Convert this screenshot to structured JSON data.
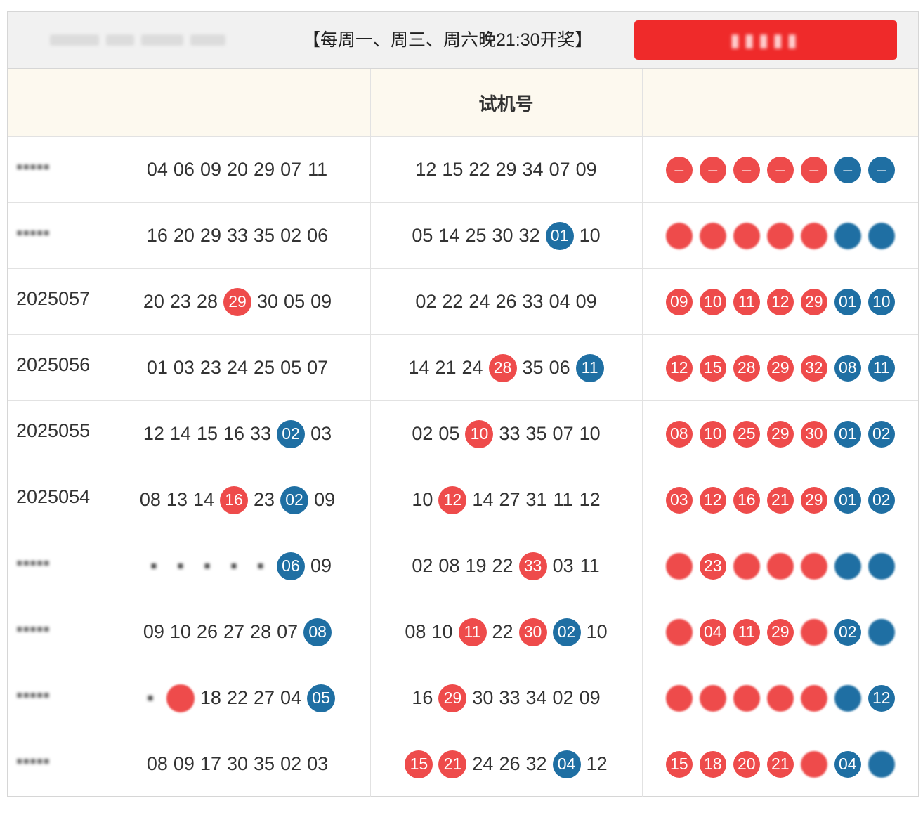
{
  "header": {
    "schedule": "【每周一、周三、周六晚21:30开奖】"
  },
  "table": {
    "col3_header": "试机号",
    "rows": [
      {
        "issue": "",
        "issue_blurred": true,
        "draw": [
          {
            "v": "04"
          },
          {
            "v": "06"
          },
          {
            "v": "09"
          },
          {
            "v": "20"
          },
          {
            "v": "29"
          },
          {
            "v": "07"
          },
          {
            "v": "11"
          }
        ],
        "trial": [
          {
            "v": "12"
          },
          {
            "v": "15"
          },
          {
            "v": "22"
          },
          {
            "v": "29"
          },
          {
            "v": "34"
          },
          {
            "v": "07"
          },
          {
            "v": "09"
          }
        ],
        "result": [
          {
            "v": "–",
            "c": "red"
          },
          {
            "v": "–",
            "c": "red"
          },
          {
            "v": "–",
            "c": "red"
          },
          {
            "v": "–",
            "c": "red"
          },
          {
            "v": "–",
            "c": "red"
          },
          {
            "v": "–",
            "c": "blue"
          },
          {
            "v": "–",
            "c": "blue"
          }
        ]
      },
      {
        "issue": "",
        "issue_blurred": true,
        "draw": [
          {
            "v": "16"
          },
          {
            "v": "20"
          },
          {
            "v": "29"
          },
          {
            "v": "33"
          },
          {
            "v": "35"
          },
          {
            "v": "02"
          },
          {
            "v": "06"
          }
        ],
        "trial": [
          {
            "v": "05"
          },
          {
            "v": "14"
          },
          {
            "v": "25"
          },
          {
            "v": "30"
          },
          {
            "v": "32"
          },
          {
            "v": "01",
            "c": "blue"
          },
          {
            "v": "10"
          }
        ],
        "result": [
          {
            "v": "",
            "c": "red",
            "b": true
          },
          {
            "v": "",
            "c": "red",
            "b": true
          },
          {
            "v": "",
            "c": "red",
            "b": true
          },
          {
            "v": "",
            "c": "red",
            "b": true
          },
          {
            "v": "",
            "c": "red",
            "b": true
          },
          {
            "v": "",
            "c": "blue",
            "b": true
          },
          {
            "v": "",
            "c": "blue",
            "b": true
          }
        ]
      },
      {
        "issue": "2025057",
        "draw": [
          {
            "v": "20"
          },
          {
            "v": "23"
          },
          {
            "v": "28"
          },
          {
            "v": "29",
            "c": "red"
          },
          {
            "v": "30"
          },
          {
            "v": "05"
          },
          {
            "v": "09"
          }
        ],
        "trial": [
          {
            "v": "02"
          },
          {
            "v": "22"
          },
          {
            "v": "24"
          },
          {
            "v": "26"
          },
          {
            "v": "33"
          },
          {
            "v": "04"
          },
          {
            "v": "09"
          }
        ],
        "result": [
          {
            "v": "09",
            "c": "red"
          },
          {
            "v": "10",
            "c": "red"
          },
          {
            "v": "11",
            "c": "red"
          },
          {
            "v": "12",
            "c": "red"
          },
          {
            "v": "29",
            "c": "red"
          },
          {
            "v": "01",
            "c": "blue"
          },
          {
            "v": "10",
            "c": "blue"
          }
        ]
      },
      {
        "issue": "2025056",
        "draw": [
          {
            "v": "01"
          },
          {
            "v": "03"
          },
          {
            "v": "23"
          },
          {
            "v": "24"
          },
          {
            "v": "25"
          },
          {
            "v": "05"
          },
          {
            "v": "07"
          }
        ],
        "trial": [
          {
            "v": "14"
          },
          {
            "v": "21"
          },
          {
            "v": "24"
          },
          {
            "v": "28",
            "c": "red"
          },
          {
            "v": "35"
          },
          {
            "v": "06"
          },
          {
            "v": "11",
            "c": "blue"
          }
        ],
        "result": [
          {
            "v": "12",
            "c": "red"
          },
          {
            "v": "15",
            "c": "red"
          },
          {
            "v": "28",
            "c": "red"
          },
          {
            "v": "29",
            "c": "red"
          },
          {
            "v": "32",
            "c": "red"
          },
          {
            "v": "08",
            "c": "blue"
          },
          {
            "v": "11",
            "c": "blue"
          }
        ]
      },
      {
        "issue": "2025055",
        "draw": [
          {
            "v": "12"
          },
          {
            "v": "14"
          },
          {
            "v": "15"
          },
          {
            "v": "16"
          },
          {
            "v": "33"
          },
          {
            "v": "02",
            "c": "blue"
          },
          {
            "v": "03"
          }
        ],
        "trial": [
          {
            "v": "02"
          },
          {
            "v": "05"
          },
          {
            "v": "10",
            "c": "red"
          },
          {
            "v": "33"
          },
          {
            "v": "35"
          },
          {
            "v": "07"
          },
          {
            "v": "10"
          }
        ],
        "result": [
          {
            "v": "08",
            "c": "red"
          },
          {
            "v": "10",
            "c": "red"
          },
          {
            "v": "25",
            "c": "red"
          },
          {
            "v": "29",
            "c": "red"
          },
          {
            "v": "30",
            "c": "red"
          },
          {
            "v": "01",
            "c": "blue"
          },
          {
            "v": "02",
            "c": "blue"
          }
        ]
      },
      {
        "issue": "2025054",
        "draw": [
          {
            "v": "08"
          },
          {
            "v": "13"
          },
          {
            "v": "14"
          },
          {
            "v": "16",
            "c": "red"
          },
          {
            "v": "23"
          },
          {
            "v": "02",
            "c": "blue"
          },
          {
            "v": "09"
          }
        ],
        "trial": [
          {
            "v": "10"
          },
          {
            "v": "12",
            "c": "red"
          },
          {
            "v": "14"
          },
          {
            "v": "27"
          },
          {
            "v": "31"
          },
          {
            "v": "11"
          },
          {
            "v": "12"
          }
        ],
        "result": [
          {
            "v": "03",
            "c": "red"
          },
          {
            "v": "12",
            "c": "red"
          },
          {
            "v": "16",
            "c": "red"
          },
          {
            "v": "21",
            "c": "red"
          },
          {
            "v": "29",
            "c": "red"
          },
          {
            "v": "01",
            "c": "blue"
          },
          {
            "v": "02",
            "c": "blue"
          }
        ]
      },
      {
        "issue": "",
        "issue_blurred": true,
        "draw": [
          {
            "v": "",
            "b": true
          },
          {
            "v": "",
            "b": true
          },
          {
            "v": "",
            "b": true
          },
          {
            "v": "",
            "b": true
          },
          {
            "v": "",
            "b": true
          },
          {
            "v": "06",
            "c": "blue"
          },
          {
            "v": "09"
          }
        ],
        "trial": [
          {
            "v": "02"
          },
          {
            "v": "08"
          },
          {
            "v": "19"
          },
          {
            "v": "22"
          },
          {
            "v": "33",
            "c": "red"
          },
          {
            "v": "03"
          },
          {
            "v": "11"
          }
        ],
        "result": [
          {
            "v": "",
            "c": "red",
            "b": true
          },
          {
            "v": "23",
            "c": "red"
          },
          {
            "v": "",
            "c": "red",
            "b": true
          },
          {
            "v": "",
            "c": "red",
            "b": true
          },
          {
            "v": "",
            "c": "red",
            "b": true
          },
          {
            "v": "",
            "c": "blue",
            "b": true
          },
          {
            "v": "",
            "c": "blue",
            "b": true
          }
        ]
      },
      {
        "issue": "",
        "issue_blurred": true,
        "draw": [
          {
            "v": "09"
          },
          {
            "v": "10"
          },
          {
            "v": "26"
          },
          {
            "v": "27"
          },
          {
            "v": "28"
          },
          {
            "v": "07"
          },
          {
            "v": "08",
            "c": "blue"
          }
        ],
        "trial": [
          {
            "v": "08"
          },
          {
            "v": "10"
          },
          {
            "v": "11",
            "c": "red"
          },
          {
            "v": "22"
          },
          {
            "v": "30",
            "c": "red"
          },
          {
            "v": "02",
            "c": "blue"
          },
          {
            "v": "10"
          }
        ],
        "result": [
          {
            "v": "",
            "c": "red",
            "b": true
          },
          {
            "v": "04",
            "c": "red"
          },
          {
            "v": "11",
            "c": "red"
          },
          {
            "v": "29",
            "c": "red"
          },
          {
            "v": "",
            "c": "red",
            "b": true
          },
          {
            "v": "02",
            "c": "blue"
          },
          {
            "v": "",
            "c": "blue",
            "b": true
          }
        ]
      },
      {
        "issue": "",
        "issue_blurred": true,
        "draw": [
          {
            "v": "",
            "b": true
          },
          {
            "v": "",
            "c": "red",
            "b": true
          },
          {
            "v": "18"
          },
          {
            "v": "22"
          },
          {
            "v": "27"
          },
          {
            "v": "04"
          },
          {
            "v": "05",
            "c": "blue"
          }
        ],
        "trial": [
          {
            "v": "16"
          },
          {
            "v": "29",
            "c": "red"
          },
          {
            "v": "30"
          },
          {
            "v": "33"
          },
          {
            "v": "34"
          },
          {
            "v": "02"
          },
          {
            "v": "09"
          }
        ],
        "result": [
          {
            "v": "",
            "c": "red",
            "b": true
          },
          {
            "v": "",
            "c": "red",
            "b": true
          },
          {
            "v": "",
            "c": "red",
            "b": true
          },
          {
            "v": "",
            "c": "red",
            "b": true
          },
          {
            "v": "",
            "c": "red",
            "b": true
          },
          {
            "v": "",
            "c": "blue",
            "b": true
          },
          {
            "v": "12",
            "c": "blue"
          }
        ]
      },
      {
        "issue": "",
        "issue_blurred": true,
        "draw": [
          {
            "v": "08"
          },
          {
            "v": "09"
          },
          {
            "v": "17"
          },
          {
            "v": "30"
          },
          {
            "v": "35"
          },
          {
            "v": "02"
          },
          {
            "v": "03"
          }
        ],
        "trial": [
          {
            "v": "15",
            "c": "red"
          },
          {
            "v": "21",
            "c": "red"
          },
          {
            "v": "24"
          },
          {
            "v": "26"
          },
          {
            "v": "32"
          },
          {
            "v": "04",
            "c": "blue"
          },
          {
            "v": "12"
          }
        ],
        "result": [
          {
            "v": "15",
            "c": "red"
          },
          {
            "v": "18",
            "c": "red"
          },
          {
            "v": "20",
            "c": "red"
          },
          {
            "v": "21",
            "c": "red"
          },
          {
            "v": "",
            "c": "red",
            "b": true
          },
          {
            "v": "04",
            "c": "blue"
          },
          {
            "v": "",
            "c": "blue",
            "b": true
          }
        ]
      }
    ]
  },
  "colors": {
    "red_ball": "#ee4b4b",
    "blue_ball": "#1f6fa3",
    "header_bg": "#fdf9ef",
    "button_red": "#ef2a2a"
  }
}
